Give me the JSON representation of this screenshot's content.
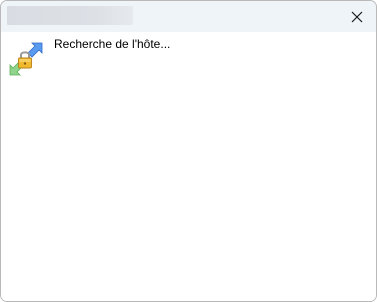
{
  "window": {
    "title": ""
  },
  "titlebar": {
    "close_icon": "close-icon"
  },
  "content": {
    "icon": "connection-lock-icon",
    "status_text": "Recherche de l'hôte..."
  },
  "colors": {
    "titlebar_bg": "#eff4f9",
    "window_border": "#b9b9b9",
    "arrow_blue": "#3f7fe0",
    "arrow_green": "#8fd48a",
    "lock_gold": "#e2a521"
  }
}
